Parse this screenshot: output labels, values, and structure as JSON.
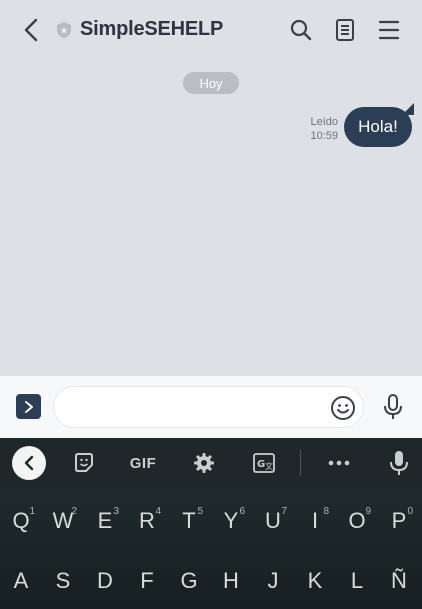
{
  "header": {
    "title": "SimpleSEHELP"
  },
  "chat": {
    "date": "Hoy",
    "message": {
      "status": "Leído",
      "time": "10:59",
      "text": "Hola!"
    }
  },
  "input": {
    "placeholder": ""
  },
  "keyboard": {
    "toolbar": {
      "gif_label": "GIF"
    },
    "row1": [
      {
        "key": "Q",
        "hint": "1"
      },
      {
        "key": "W",
        "hint": "2"
      },
      {
        "key": "E",
        "hint": "3"
      },
      {
        "key": "R",
        "hint": "4"
      },
      {
        "key": "T",
        "hint": "5"
      },
      {
        "key": "Y",
        "hint": "6"
      },
      {
        "key": "U",
        "hint": "7"
      },
      {
        "key": "I",
        "hint": "8"
      },
      {
        "key": "O",
        "hint": "9"
      },
      {
        "key": "P",
        "hint": "0"
      }
    ],
    "row2": [
      {
        "key": "A"
      },
      {
        "key": "S"
      },
      {
        "key": "D"
      },
      {
        "key": "F"
      },
      {
        "key": "G"
      },
      {
        "key": "H"
      },
      {
        "key": "J"
      },
      {
        "key": "K"
      },
      {
        "key": "L"
      },
      {
        "key": "Ñ"
      }
    ]
  },
  "colors": {
    "accent": "#2c3e55",
    "background": "#dde1e5",
    "keyboard": "#1b2426"
  }
}
